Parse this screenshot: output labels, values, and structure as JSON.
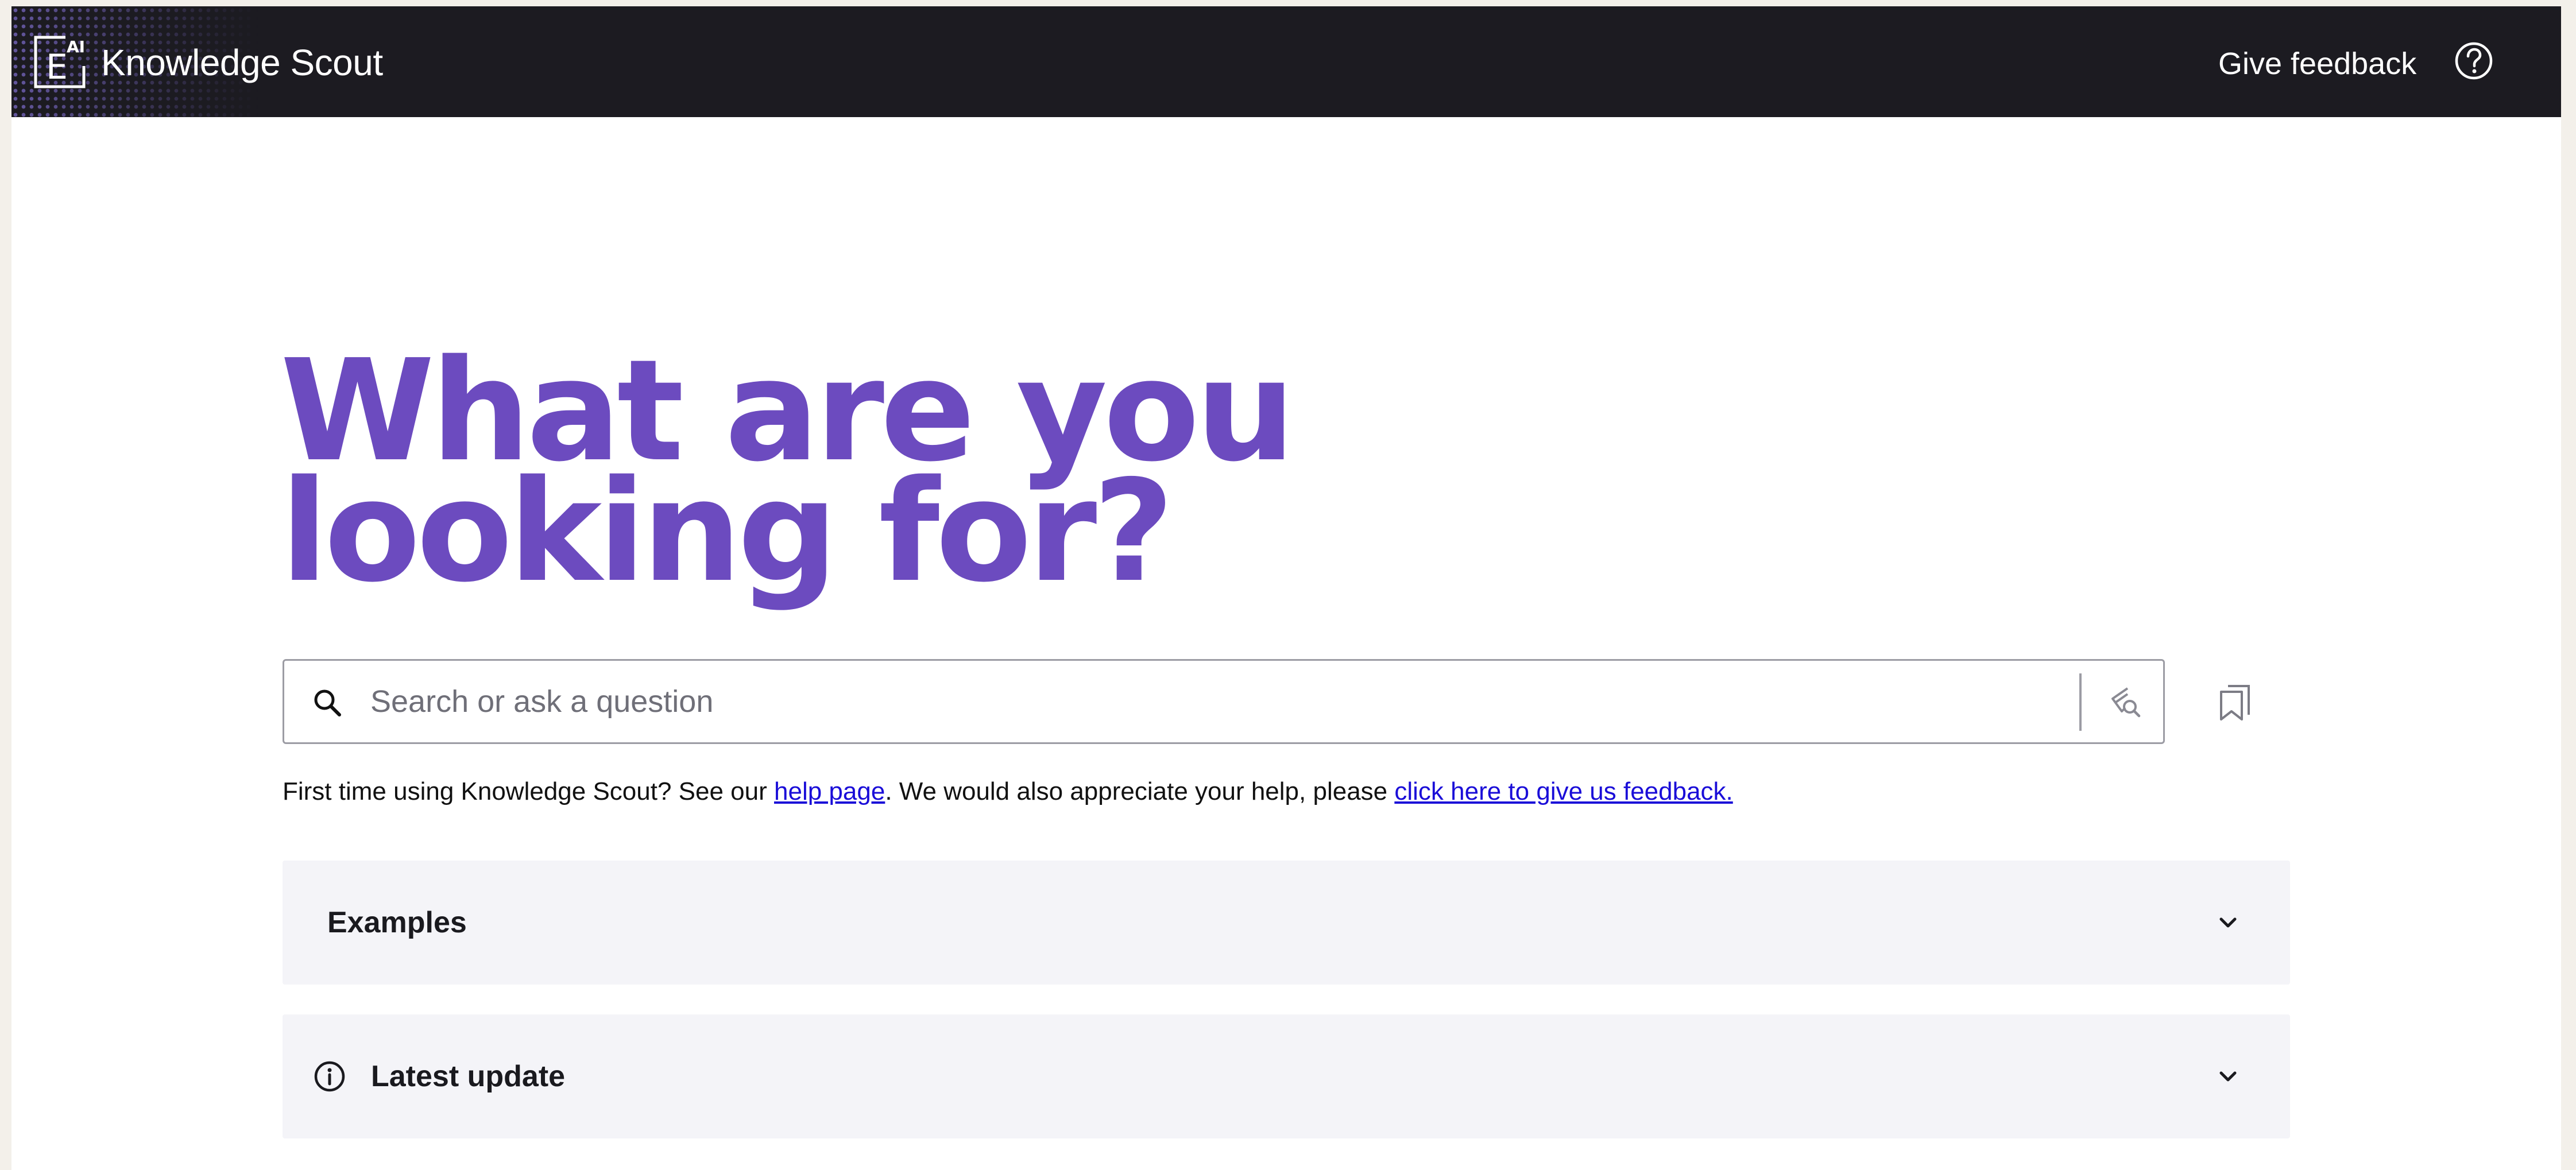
{
  "header": {
    "logo_text": "E",
    "logo_superscript": "AI",
    "app_title": "Knowledge Scout",
    "feedback_label": "Give feedback",
    "help_icon": "question-circle-icon"
  },
  "hero": {
    "title_line1": "What are you",
    "title_line2": "looking for?"
  },
  "search": {
    "placeholder": "Search or ask a question",
    "value": "",
    "left_icon": "search-icon",
    "right_icon": "filter-search-icon"
  },
  "bookmarks": {
    "icon": "bookmarks-icon"
  },
  "intro": {
    "text_before": "First time using Knowledge Scout? See our ",
    "help_link": "help page",
    "text_middle": ". We would also appreciate your help, please ",
    "feedback_link": "click here to give us feedback."
  },
  "accordions": [
    {
      "title": "Examples",
      "icon": "chevron-down-icon"
    },
    {
      "title": "Latest update",
      "leading_icon": "info-icon",
      "icon": "chevron-down-icon"
    }
  ],
  "colors": {
    "header_bg": "#1c1b21",
    "accent_purple": "#6c4bbf",
    "link_blue": "#1a0dd8",
    "panel_bg": "#f4f4f8"
  }
}
